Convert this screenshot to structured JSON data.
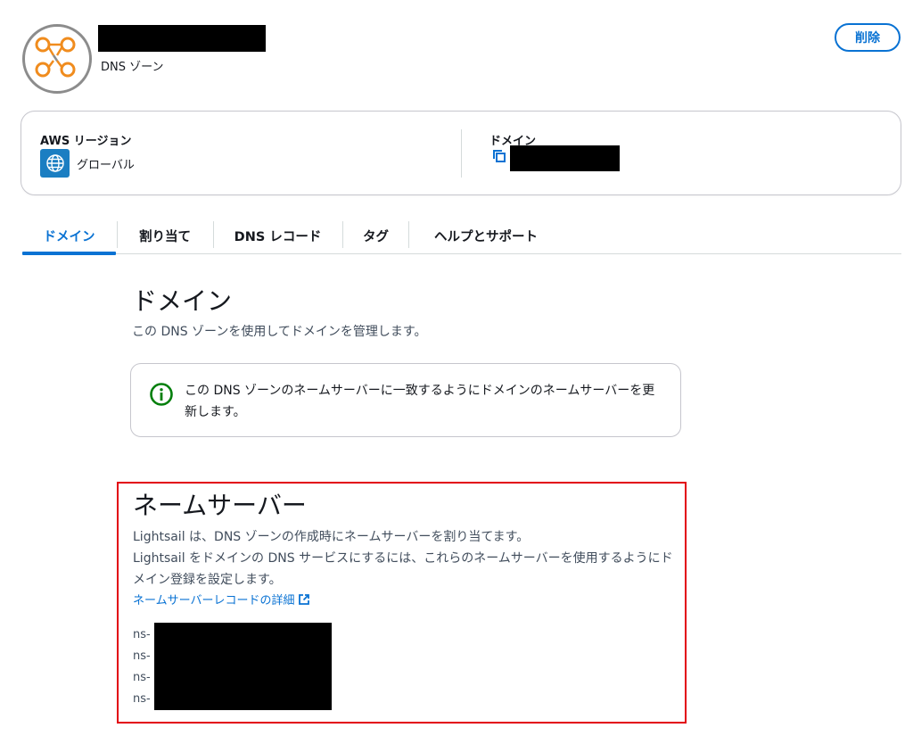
{
  "header": {
    "subtitle": "DNS ゾーン",
    "delete_label": "削除"
  },
  "info": {
    "region_label": "AWS リージョン",
    "region_value": "グローバル",
    "domain_label": "ドメイン"
  },
  "tabs": [
    {
      "label": "ドメイン",
      "active": true
    },
    {
      "label": "割り当て",
      "active": false
    },
    {
      "label": "DNS レコード",
      "active": false
    },
    {
      "label": "タグ",
      "active": false
    },
    {
      "label": "ヘルプとサポート",
      "active": false
    }
  ],
  "domain_section": {
    "heading": "ドメイン",
    "description": "この DNS ゾーンを使用してドメインを管理します。",
    "alert_text": "この DNS ゾーンのネームサーバーに一致するようにドメインのネームサーバーを更新します。"
  },
  "nameserver_section": {
    "heading": "ネームサーバー",
    "description_1": "Lightsail は、DNS ゾーンの作成時にネームサーバーを割り当てます。",
    "description_2": "Lightsail をドメインの DNS サービスにするには、これらのネームサーバーを使用するようにドメイン登録を設定します。",
    "link_label": "ネームサーバーレコードの詳細",
    "servers": [
      "ns-",
      "ns-",
      "ns-",
      "ns-"
    ]
  },
  "colors": {
    "accent": "#0972d3",
    "highlight_border": "#e2000f",
    "icon_orange": "#f08c1e",
    "globe_blue": "#1b7ec2",
    "info_green": "#037f0c"
  },
  "icons": {
    "zone_icon": "dns-zone-icon",
    "globe_icon": "globe-icon",
    "copy_icon": "copy-icon",
    "info_icon": "info-icon",
    "external_link_icon": "external-link-icon"
  }
}
